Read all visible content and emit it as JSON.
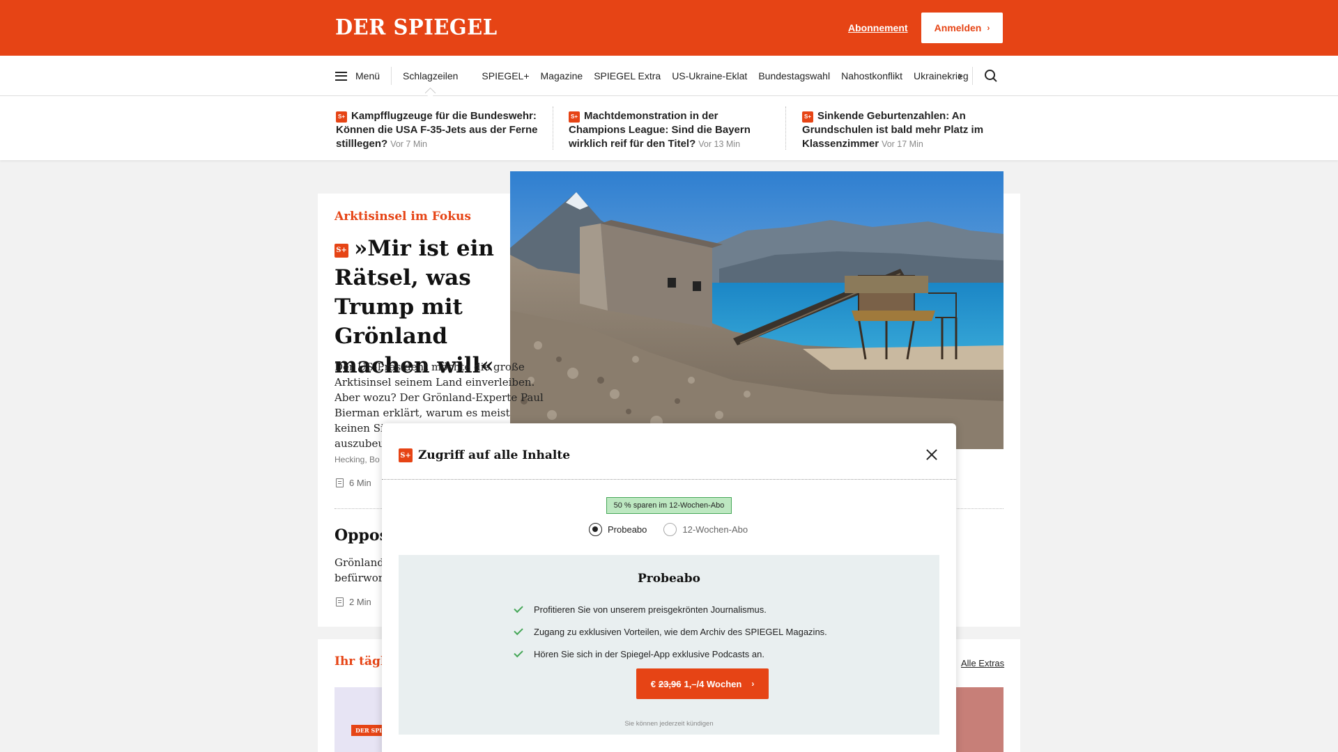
{
  "header": {
    "logo": "DER SPIEGEL",
    "subscription_link": "Abonnement",
    "login_button": "Anmelden",
    "brand_color": "#e64415"
  },
  "nav": {
    "menu_label": "Menü",
    "items": [
      {
        "label": "Schlagzeilen",
        "active": true
      },
      {
        "label": "SPIEGEL+"
      },
      {
        "label": "Magazine"
      },
      {
        "label": "SPIEGEL Extra"
      },
      {
        "label": "US-Ukraine-Eklat"
      },
      {
        "label": "Bundestagswahl"
      },
      {
        "label": "Nahostkonflikt"
      },
      {
        "label": "Ukrainekrieg"
      }
    ],
    "next_icon": "chevron-right-icon",
    "search_icon": "search-icon"
  },
  "ticker": [
    {
      "title": "Kampfflugzeuge für die Bundeswehr: Können die USA F-35-Jets aus der Ferne stilllegen?",
      "time": "Vor 7 Min"
    },
    {
      "title": "Machtdemonstration in der Champions League: Sind die Bayern wirklich reif für den Titel?",
      "time": "Vor 13 Min"
    },
    {
      "title": "Sinkende Geburtenzahlen: An Grundschulen ist bald mehr Platz im Klassenzimmer",
      "time": "Vor 17 Min"
    }
  ],
  "splus_badge": "S+",
  "main_article": {
    "kicker": "Arktisinsel im Fokus",
    "headline": "»Mir ist ein Rätsel, was Trump mit Grönland machen will«",
    "teaser": "Der US-Präsident möchte die große Arktisinsel seinem Land einverleiben. Aber wozu? Der Grönland-Experte Paul Bierman erklärt, warum es meist keinen Sinn ergibt, die Insel auszubeuten.",
    "byline": "Hecking, Bo",
    "read_time": "6 Min"
  },
  "second_article": {
    "headline": "Opposition",
    "teaser": "Grönland befürwort",
    "read_time": "2 Min"
  },
  "lower_section": {
    "title": "Ihr täglich",
    "all_extras": "Alle Extras",
    "badge": "DER SPIEGEL"
  },
  "modal": {
    "title": "Zugriff auf alle Inhalte",
    "save_badge": "50 % sparen im 12-Wochen-Abo",
    "options": [
      {
        "label": "Probeabo",
        "selected": true
      },
      {
        "label": "12-Wochen-Abo",
        "selected": false
      }
    ],
    "offer_title": "Probeabo",
    "features": [
      "Profitieren Sie von unserem preisgekrönten Journalismus.",
      "Zugang zu exklusiven Vorteilen, wie dem Archiv des SPIEGEL Magazins.",
      "Hören Sie sich in der Spiegel-App exklusive Podcasts an."
    ],
    "cta_prefix": "€",
    "cta_old_price": "23,96",
    "cta_new_price": "1,–/4 Wochen",
    "cancel_note": "Sie können jederzeit kündigen",
    "accent_green": "#46a758"
  }
}
